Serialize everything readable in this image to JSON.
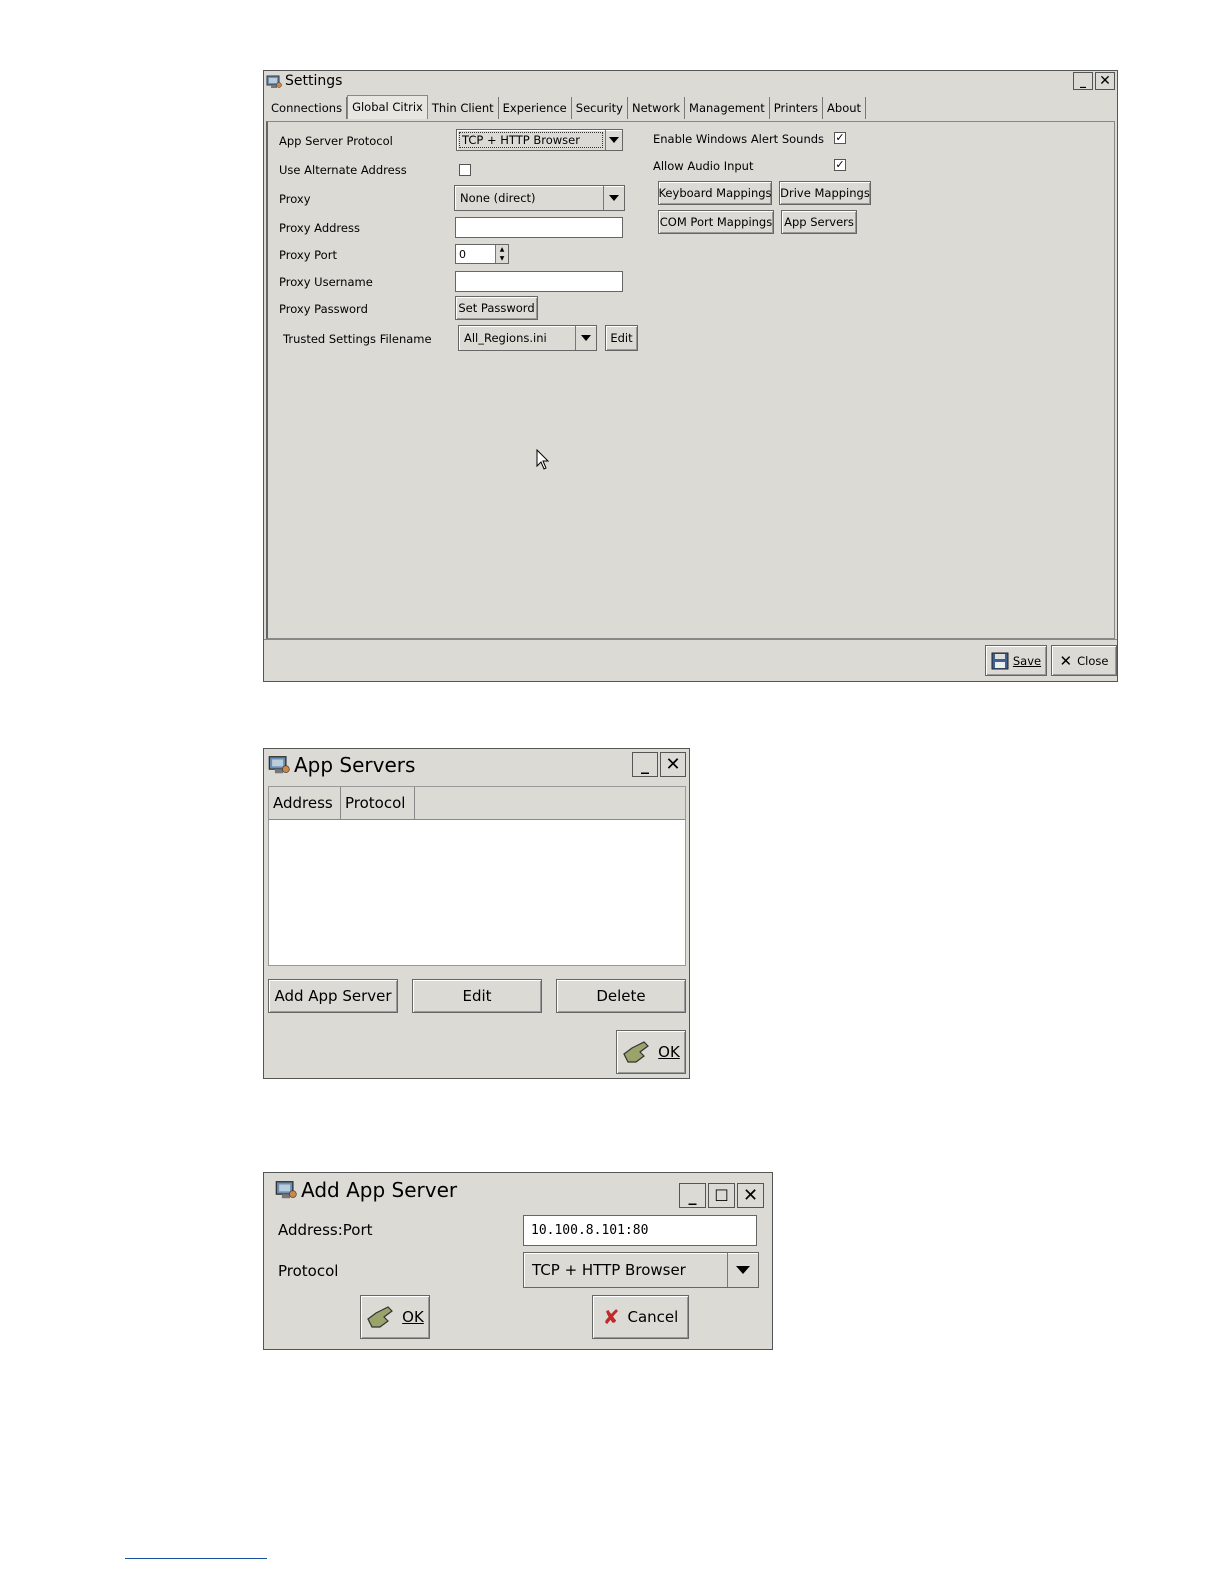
{
  "settings": {
    "title": "Settings",
    "tabs": [
      "Connections",
      "Global Citrix",
      "Thin Client",
      "Experience",
      "Security",
      "Network",
      "Management",
      "Printers",
      "About"
    ],
    "active_tab": "Global Citrix",
    "fields": {
      "app_server_protocol_label": "App Server Protocol",
      "app_server_protocol_value": "TCP + HTTP Browser",
      "use_alternate_address_label": "Use Alternate Address",
      "use_alternate_address_checked": false,
      "proxy_label": "Proxy",
      "proxy_value": "None (direct)",
      "proxy_address_label": "Proxy Address",
      "proxy_address_value": "",
      "proxy_port_label": "Proxy Port",
      "proxy_port_value": "0",
      "proxy_username_label": "Proxy Username",
      "proxy_username_value": "",
      "proxy_password_label": "Proxy Password",
      "set_password_label": "Set Password",
      "trusted_settings_label": "Trusted Settings Filename",
      "trusted_settings_value": "All_Regions.ini",
      "edit_label": "Edit",
      "enable_alert_sounds_label": "Enable Windows Alert Sounds",
      "enable_alert_sounds_checked": true,
      "allow_audio_input_label": "Allow Audio Input",
      "allow_audio_input_checked": true,
      "keyboard_mappings_label": "Keyboard Mappings",
      "drive_mappings_label": "Drive Mappings",
      "com_port_mappings_label": "COM Port Mappings",
      "app_servers_label": "App Servers"
    },
    "save_label": "Save",
    "close_label": "Close"
  },
  "app_servers": {
    "title": "App Servers",
    "columns": [
      "Address",
      "Protocol"
    ],
    "rows": [],
    "add_label": "Add App Server",
    "edit_label": "Edit",
    "delete_label": "Delete",
    "ok_label": "OK"
  },
  "add_app_server": {
    "title": "Add App Server",
    "address_port_label": "Address:Port",
    "address_port_value": "10.100.8.101:80",
    "protocol_label": "Protocol",
    "protocol_value": "TCP + HTTP Browser",
    "ok_label": "OK",
    "cancel_label": "Cancel"
  }
}
